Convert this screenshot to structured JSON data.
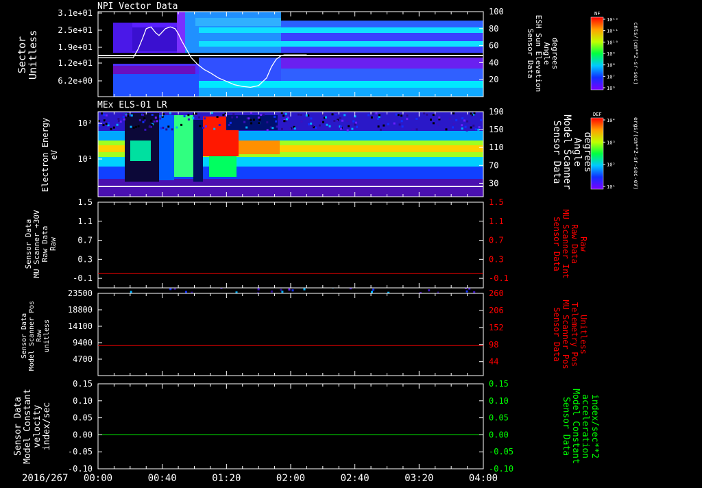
{
  "chart_data": [
    {
      "type": "heatmap",
      "title": "NPI Vector Data",
      "ylabel": "Sector\nUnitless",
      "y_ticks": [
        "3.1e+01",
        "2.5e+01",
        "1.9e+01",
        "1.2e+01",
        "6.2e+00"
      ],
      "right_ylabel": "Sensor Data\nESH Sun Elevation\nAngle\ndegrees",
      "right_ylim": [
        0,
        100
      ],
      "right_ticks": [
        20,
        40,
        60,
        80,
        100
      ],
      "overlay_line": {
        "color": "#ffffff",
        "x_minutes": [
          0,
          16,
          22,
          25,
          28,
          30,
          33,
          36,
          38,
          42,
          45,
          48,
          50,
          52,
          55,
          58,
          62,
          66,
          70,
          75,
          80,
          85,
          90,
          95,
          100,
          105,
          108,
          111,
          114,
          116,
          118,
          120,
          125,
          130
        ],
        "y_degrees": [
          46,
          46,
          46,
          56,
          70,
          80,
          82,
          75,
          72,
          80,
          82,
          80,
          74,
          66,
          56,
          46,
          38,
          32,
          28,
          22,
          18,
          14,
          12,
          11,
          13,
          22,
          35,
          44,
          48,
          49,
          49,
          49,
          49,
          49
        ]
      },
      "colorbar": {
        "label": "NF",
        "units": "cnts/(cm**2-sr-sec)",
        "ticks": [
          "10¹²",
          "10¹¹",
          "10¹⁰",
          "10⁹",
          "10⁸",
          "10⁷",
          "10⁶"
        ]
      }
    },
    {
      "type": "heatmap",
      "title": "MEx ELS-01 LR",
      "ylabel": "Electron Energy\neV",
      "y_ticks": [
        "10²",
        "10¹"
      ],
      "right_ylabel": "Sensor Data\nModel Scanner\nAngle\ndegrees",
      "right_ylim": [
        0,
        190
      ],
      "right_ticks": [
        30,
        70,
        110,
        150,
        190
      ],
      "colorbar": {
        "label": "DEF",
        "units": "ergs/(cm**2-sr-sec-eV)",
        "ticks": [
          "10⁴",
          "10³",
          "10²",
          "10¹"
        ]
      }
    },
    {
      "type": "line",
      "ylabel": "Sensor Data\nMU Scanner +30V\nRaw Data\nRaw",
      "ylim": [
        -0.3,
        1.5
      ],
      "ticks": [
        "1.5",
        "1.1",
        "0.7",
        "0.3",
        "-0.1"
      ],
      "right_ylabel": "Sensor Data\nMU Scanner Int\nRaw Data\nRaw",
      "right_ticks": [
        "1.5",
        "1.1",
        "0.7",
        "0.3",
        "-0.1"
      ],
      "right_label_color": "#ff0000",
      "series": [
        {
          "color": "#ff0000",
          "constant": 0.0
        }
      ]
    },
    {
      "type": "line",
      "ylabel": "Sensor Data\nModel Scanner Pos\nRaw\nunitless",
      "ylim": [
        0,
        23500
      ],
      "ticks": [
        "23500",
        "18800",
        "14100",
        "9400",
        "4700"
      ],
      "right_ylabel": "Sensor Data\nMU Scanner Pos\nTelemetry Pos\nUnitless",
      "right_ylim": [
        0,
        260
      ],
      "right_ticks": [
        "260",
        "206",
        "152",
        "98",
        "44"
      ],
      "right_label_color": "#ff0000",
      "series": [
        {
          "color": "#ff0000",
          "constant": 8600
        }
      ]
    },
    {
      "type": "line",
      "ylabel": "Sensor Data\nModel Constant\nvelocity\nindex/sec",
      "ylim": [
        -0.1,
        0.15
      ],
      "ticks": [
        "0.15",
        "0.10",
        "0.05",
        "0.00",
        "-0.05",
        "-0.10"
      ],
      "right_ylabel": "Sensor Data\nModel Constant\nacceleration\nindex/sec**2",
      "right_ticks": [
        "0.15",
        "0.10",
        "0.05",
        "0.00",
        "-0.05",
        "-0.10"
      ],
      "right_label_color": "#00ff00",
      "series": [
        {
          "color": "#00ff00",
          "constant": 0.0
        }
      ]
    }
  ],
  "x_axis": {
    "date_label": "2016/267",
    "ticks": [
      "00:00",
      "00:40",
      "01:20",
      "02:00",
      "02:40",
      "03:20",
      "04:00"
    ],
    "range_minutes": [
      0,
      240
    ]
  }
}
